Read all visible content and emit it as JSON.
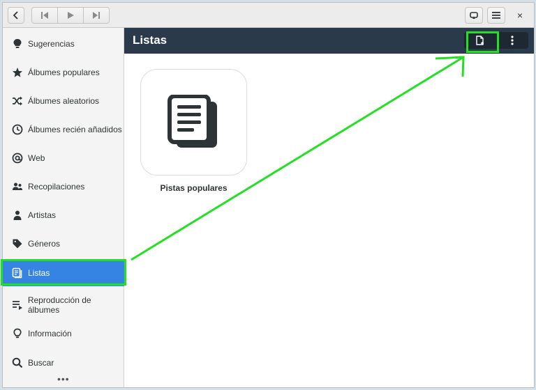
{
  "headerbar": {
    "back_icon": "chevron-left-icon",
    "prev_icon": "skip-previous-icon",
    "play_icon": "play-icon",
    "next_icon": "skip-next-icon",
    "repeat_icon": "repeat-icon",
    "menu_icon": "hamburger-menu-icon",
    "close_label": "×"
  },
  "sidebar": {
    "items": [
      {
        "label": "Sugerencias",
        "icon": "lightbulb-icon"
      },
      {
        "label": "Álbumes populares",
        "icon": "star-icon"
      },
      {
        "label": "Álbumes aleatorios",
        "icon": "shuffle-icon"
      },
      {
        "label": "Álbumes recién añadidos",
        "icon": "clock-icon"
      },
      {
        "label": "Web",
        "icon": "at-sign-icon"
      },
      {
        "label": "Recopilaciones",
        "icon": "people-icon"
      },
      {
        "label": "Artistas",
        "icon": "person-icon"
      },
      {
        "label": "Géneros",
        "icon": "tag-icon"
      },
      {
        "label": "Listas",
        "icon": "playlist-icon",
        "active": true
      },
      {
        "label": "Reproducción de álbumes",
        "icon": "queue-icon"
      },
      {
        "label": "Información",
        "icon": "lightbulb-outline-icon"
      },
      {
        "label": "Buscar",
        "icon": "search-icon"
      }
    ],
    "more_label": "•••"
  },
  "content": {
    "title": "Listas",
    "new_playlist_icon": "new-document-icon",
    "more_icon": "vertical-dots-icon",
    "playlists": [
      {
        "label": "Pistas populares",
        "icon": "documents-icon"
      }
    ]
  },
  "colors": {
    "accent": "#3584e4",
    "content_header": "#2b3a4a",
    "annotation": "#22e022"
  }
}
